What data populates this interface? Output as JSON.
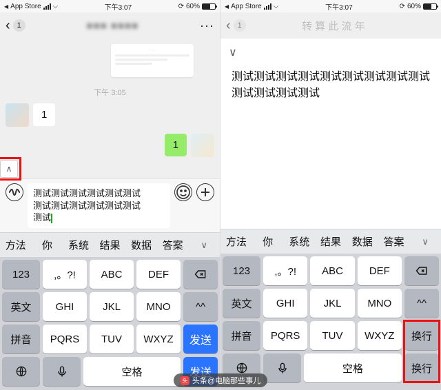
{
  "status": {
    "app_back": "App Store",
    "time": "下午3:07",
    "battery_pct": "60%"
  },
  "left": {
    "nav_count": "1",
    "nav_title": "■■■ ■■■■",
    "chat_time": "下午 3:05",
    "msg_in": "1",
    "msg_out": "1",
    "input_text_l1": "测试测试测试测试测试测试",
    "input_text_l2": "测试测试测试测试测试测试",
    "input_text_l3": "测试"
  },
  "right": {
    "nav_title": "转 算 此 流 年",
    "panel_text_l1": "测试测试测试测试测试测试测试测试测试",
    "panel_text_l2": "测试测试测试测试"
  },
  "candidates": [
    "方法",
    "你",
    "系统",
    "结果",
    "数据",
    "答案"
  ],
  "cand_more": "∨",
  "kbd": {
    "r1": {
      "a": "123",
      "b": ",。?!",
      "c": "ABC",
      "d": "DEF"
    },
    "r2": {
      "a": "英文",
      "b": "GHI",
      "c": "JKL",
      "d": "MNO",
      "e": "^^"
    },
    "r3": {
      "a": "拼音",
      "b": "PQRS",
      "c": "TUV",
      "d": "WXYZ"
    },
    "send": "发送",
    "newline": "换行",
    "space": "空格"
  },
  "watermark": "头条@电脑那些事儿"
}
